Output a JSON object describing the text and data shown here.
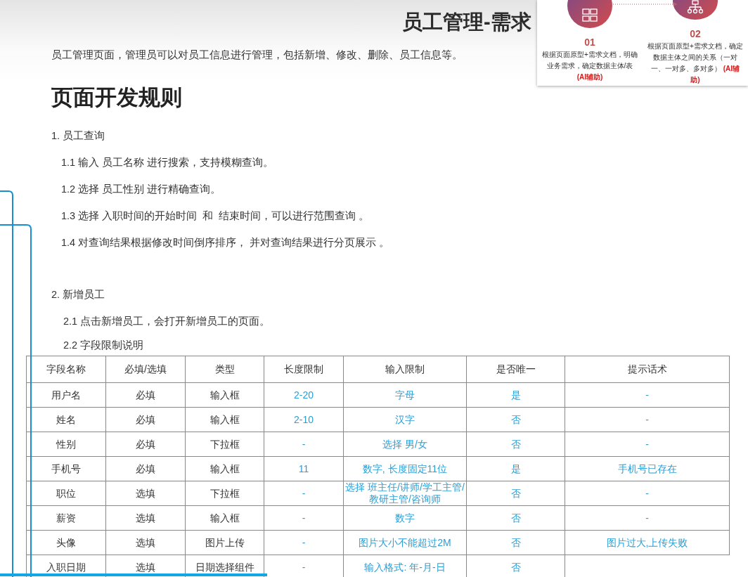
{
  "title": "员工管理-需求",
  "intro": "员工管理页面，管理员可以对员工信息进行管理，包括新增、修改、删除、员工信息等。",
  "heading": "页面开发规则",
  "steps_panel": [
    {
      "number": "01",
      "text": "根据页面原型+需求文档，明确业务需求，确定数据主体/表",
      "tag": "(AI辅助)"
    },
    {
      "number": "02",
      "text": "根据页面原型+需求文档，确定数据主体之间的关系（一对一、一对多、多对多）",
      "tag": "(AI辅助)"
    }
  ],
  "sections": [
    {
      "title": "1. 员工查询",
      "items": [
        "1.1 输入 员工名称 进行搜索，支持模糊查询。",
        "1.2 选择 员工性别 进行精确查询。",
        "1.3 选择 入职时间的开始时间  和  结束时间，可以进行范围查询 。",
        "1.4 对查询结果根据修改时间倒序排序， 并对查询结果进行分页展示 。"
      ]
    },
    {
      "title": "2. 新增员工",
      "items": [
        "2.1 点击新增员工，会打开新增员工的页面。",
        "2.2 字段限制说明"
      ]
    }
  ],
  "table": {
    "columns": [
      {
        "label": "字段名称",
        "highlight": false
      },
      {
        "label": "必填/选填",
        "highlight": false
      },
      {
        "label": "类型",
        "highlight": false
      },
      {
        "label": "长度限制",
        "highlight": true
      },
      {
        "label": "输入限制",
        "highlight": true
      },
      {
        "label": "是否唯一",
        "highlight": true
      },
      {
        "label": "提示话术",
        "highlight": true
      }
    ],
    "rows": [
      [
        "用户名",
        "必填",
        "输入框",
        "2-20",
        "字母",
        "是",
        "-"
      ],
      [
        "姓名",
        "必填",
        "输入框",
        "2-10",
        "汉字",
        "否",
        "-"
      ],
      [
        "性别",
        "必填",
        "下拉框",
        "-",
        "选择 男/女",
        "否",
        "-"
      ],
      [
        "手机号",
        "必填",
        "输入框",
        "11",
        "数字, 长度固定11位",
        "是",
        "手机号已存在"
      ],
      [
        "职位",
        "选填",
        "下拉框",
        "-",
        "选择 班主任/讲师/学工主管/教研主管/咨询师",
        "否",
        "-"
      ],
      [
        "薪资",
        "选填",
        "输入框",
        "-",
        "数字",
        "否",
        "-"
      ],
      [
        "头像",
        "选填",
        "图片上传",
        "-",
        "图片大小不能超过2M",
        "否",
        "图片过大,上传失败"
      ],
      [
        "入职日期",
        "选填",
        "日期选择组件",
        "-",
        "输入格式: 年-月-日",
        "否"
      ]
    ]
  }
}
